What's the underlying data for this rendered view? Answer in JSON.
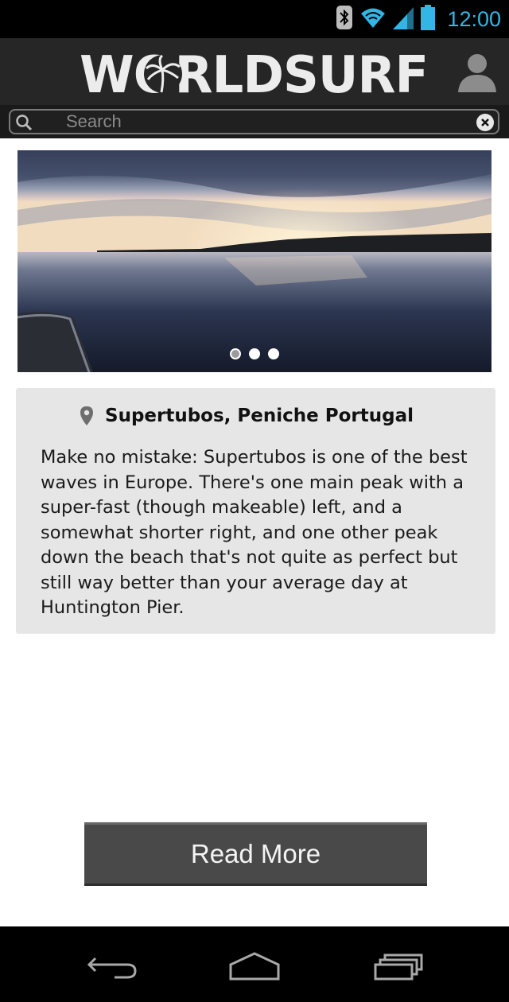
{
  "status_bar": {
    "time": "12:00",
    "icons": [
      "bluetooth-icon",
      "wifi-icon",
      "signal-icon",
      "battery-icon"
    ],
    "time_color": "#33b5e5"
  },
  "header": {
    "logo_text": "WORLDSURF",
    "profile_icon": "user-icon"
  },
  "search": {
    "placeholder": "Search",
    "value": "",
    "icon": "search-icon",
    "clear_icon": "clear-icon"
  },
  "carousel": {
    "slide_count": 3,
    "active_index": 0
  },
  "spot": {
    "location_icon": "map-pin-icon",
    "title": "Supertubos, Peniche Portugal",
    "description": "Make no mistake: Supertubos is one of the best waves in Europe. There's one main peak with a super-fast (though makeable) left, and a somewhat shorter right, and one other peak down the beach that's not quite as perfect but still way better than your average day at Huntington Pier."
  },
  "actions": {
    "read_more_label": "Read More"
  },
  "nav_bar": {
    "items": [
      "back-icon",
      "home-icon",
      "recent-apps-icon"
    ]
  }
}
